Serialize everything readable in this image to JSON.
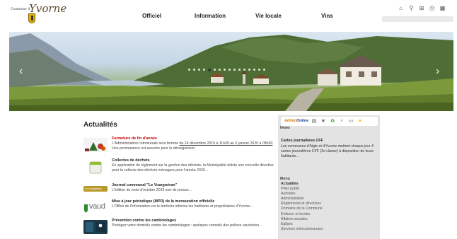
{
  "header": {
    "logo_text": "Commune d'",
    "logo_script": "Yvorne",
    "nav": [
      "Officiel",
      "Information",
      "Vie locale",
      "Vins"
    ],
    "tools": [
      {
        "icon": "home-icon",
        "glyph": "⌂"
      },
      {
        "icon": "search-icon",
        "glyph": "⚲"
      },
      {
        "icon": "sitemap-icon",
        "glyph": "⊞"
      },
      {
        "icon": "print-icon",
        "glyph": "⎙"
      },
      {
        "icon": "calendar-icon",
        "glyph": "▦"
      }
    ],
    "search": {
      "placeholder": "",
      "value": ""
    }
  },
  "slider": {
    "dot_count": 16,
    "active_index": 4,
    "prev_glyph": "‹",
    "next_glyph": "›"
  },
  "news": {
    "title": "Actualités",
    "items": [
      {
        "heading": "Fermeture de fin d'année",
        "text_before": "L'Administration communale sera fermée ",
        "text_link": "du 24 décembre 2019 à 11h30 au 6 janvier 2020 à 08h30",
        "text_after": ". Une permanence est assurée pour le déneigement.",
        "highlight": true
      },
      {
        "heading": "Collectes de déchets",
        "text": "En application du règlement sur la gestion des déchets, la Municipalité édicte une nouvelle directive pour la collecte des déchets ménagers pour l'année 2020..."
      },
      {
        "heading": "Journal communal \"Le Vuargnéran\"",
        "text": "L'édition du mois d'octobre 2019 sort de presse..."
      },
      {
        "heading": "Mise à jour périodique (MPD) de la mensuration officielle",
        "text": "L'Office de l'information sur le territoire informe les habitants et propriétaires d'Yvorne..."
      },
      {
        "heading": "Prévention contre les cambriolages",
        "text": "Protégez votre domicile contre les cambriolages : quelques conseils des polices vaudoises..."
      }
    ],
    "thumb_labels": {
      "vaud": "vaud",
      "journal": "Le Vuargnéran"
    }
  },
  "sidebar": {
    "admin_logo_a": "Admin",
    "admin_logo_b": "Online",
    "admin_icons": [
      {
        "icon": "calendar-icon",
        "glyph": "▤",
        "color": "#555555"
      },
      {
        "icon": "bird-icon",
        "glyph": "❦",
        "color": "#666666"
      },
      {
        "icon": "recycle-icon",
        "glyph": "♻",
        "color": "#2e9a2e"
      },
      {
        "icon": "tree-icon",
        "glyph": "♆",
        "color": "#2f7d2f"
      },
      {
        "icon": "bus-icon",
        "glyph": "▭",
        "color": "#555555"
      },
      {
        "icon": "sun-icon",
        "glyph": "☀",
        "color": "#f2b800"
      }
    ],
    "news_heading": "News",
    "news_title": "Cartes journalières CFF",
    "news_text": "Les communes d'Aigle et d'Yvorne mettent chaque jour 4 cartes journalières CFF (2e classe) à disposition de leurs habitants...",
    "menu_heading": "Menu",
    "menu_items": [
      "Actualités",
      "Pilier public",
      "Autorités",
      "Administration",
      "Règlements et directives",
      "Domaine de la Commune",
      "Enfance et écoles",
      "Affaires sociales",
      "Eglises",
      "Services intercommunaux"
    ]
  },
  "colors": {
    "highlight_red": "#c40000",
    "sidebar_bg": "#e3e3e3"
  }
}
